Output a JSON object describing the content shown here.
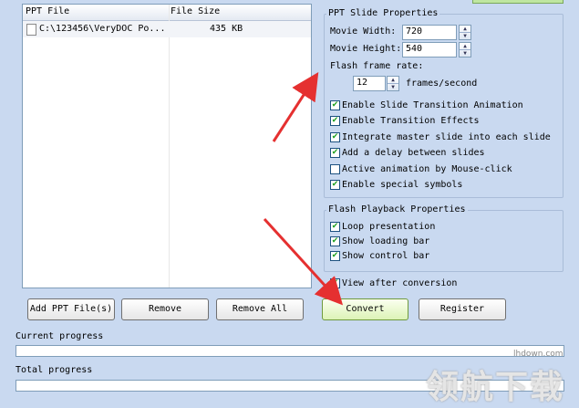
{
  "file_list": {
    "col_file": "PPT File",
    "col_size": "File Size",
    "rows": [
      {
        "file": "C:\\123456\\VeryDOC Po...",
        "size": "435 KB"
      }
    ]
  },
  "buttons": {
    "add": "Add PPT File(s)",
    "remove": "Remove",
    "remove_all": "Remove All",
    "convert": "Convert",
    "register": "Register"
  },
  "slide_props": {
    "title": "PPT Slide Properties",
    "movie_width_label": "Movie Width:",
    "movie_width": "720",
    "movie_height_label": "Movie Height:",
    "movie_height": "540",
    "frame_rate_label": "Flash frame rate:",
    "frame_rate": "12",
    "frame_rate_unit": "frames/second",
    "options": [
      {
        "label": "Enable Slide Transition Animation",
        "checked": true
      },
      {
        "label": "Enable Transition Effects",
        "checked": true
      },
      {
        "label": "Integrate master slide into each slide",
        "checked": true
      },
      {
        "label": "Add a delay between slides",
        "checked": true
      },
      {
        "label": "Active animation by Mouse-click",
        "checked": false
      },
      {
        "label": "Enable special symbols",
        "checked": true
      }
    ]
  },
  "playback": {
    "title": "Flash Playback Properties",
    "options": [
      {
        "label": "Loop presentation",
        "checked": true
      },
      {
        "label": "Show loading bar",
        "checked": true
      },
      {
        "label": "Show control bar",
        "checked": true
      }
    ]
  },
  "view_after": {
    "label": "View after conversion",
    "checked": true
  },
  "progress": {
    "current_label": "Current progress",
    "total_label": "Total progress",
    "current_value": 0,
    "total_value": 0
  },
  "watermark": {
    "text": "领航下载",
    "site": "lhdown.com"
  },
  "colors": {
    "arrow": "#e53030",
    "convert_bg": "#dcf3b6",
    "window_bg": "#c9d9f0"
  },
  "icons": {
    "check": "check-mark-icon",
    "file": "file-icon"
  }
}
